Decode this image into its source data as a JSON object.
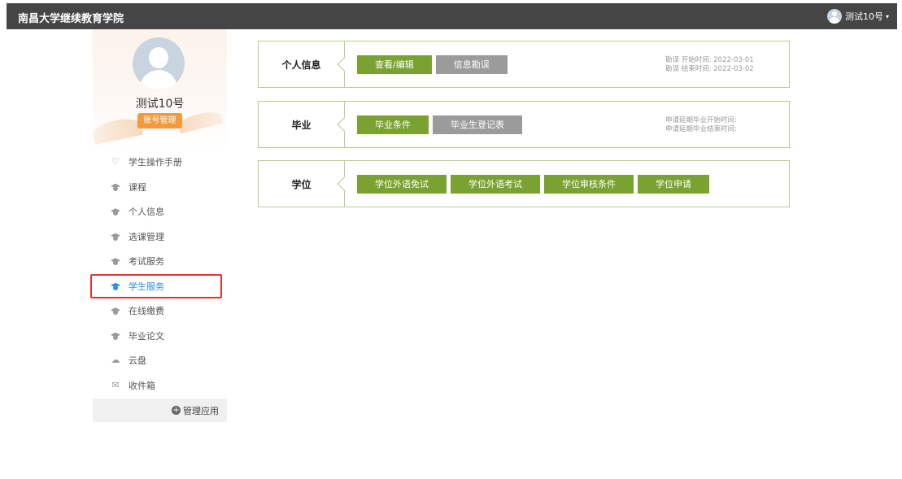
{
  "header": {
    "site_title": "南昌大学继续教育学院",
    "user_name": "测试10号",
    "caret": "▾"
  },
  "profile": {
    "name": "测试10号",
    "account_button": "账号管理"
  },
  "menu": [
    {
      "label": "学生操作手册",
      "icon": "heart-icon"
    },
    {
      "label": "课程",
      "icon": "graduation-cap-icon"
    },
    {
      "label": "个人信息",
      "icon": "graduation-cap-icon"
    },
    {
      "label": "选课管理",
      "icon": "graduation-cap-icon"
    },
    {
      "label": "考试服务",
      "icon": "graduation-cap-icon"
    },
    {
      "label": "学生服务",
      "icon": "graduation-cap-icon",
      "active": true
    },
    {
      "label": "在线缴费",
      "icon": "graduation-cap-icon"
    },
    {
      "label": "毕业论文",
      "icon": "graduation-cap-icon"
    },
    {
      "label": "云盘",
      "icon": "cloud-icon"
    },
    {
      "label": "收件箱",
      "icon": "inbox-icon"
    }
  ],
  "manage_apps": "管理应用",
  "sections": [
    {
      "label": "个人信息",
      "buttons": [
        {
          "label": "查看/编辑",
          "style": "green"
        },
        {
          "label": "信息勘误",
          "style": "gray"
        }
      ],
      "notes": [
        "勘误 开始时间: 2022-03-01",
        "勘误 结束时间: 2022-03-02"
      ]
    },
    {
      "label": "毕业",
      "buttons": [
        {
          "label": "毕业条件",
          "style": "green"
        },
        {
          "label": "毕业生登记表",
          "style": "gray"
        }
      ],
      "notes": [
        "申请延期毕业开始时间:",
        "申请延期毕业结束时间:"
      ]
    },
    {
      "label": "学位",
      "buttons": [
        {
          "label": "学位外语免试",
          "style": "green"
        },
        {
          "label": "学位外语考试",
          "style": "green"
        },
        {
          "label": "学位审核条件",
          "style": "green"
        },
        {
          "label": "学位申请",
          "style": "green"
        }
      ],
      "notes": []
    }
  ],
  "colors": {
    "topbar": "#454545",
    "accent_green": "#7aa230",
    "button_gray": "#9b9b9b",
    "active_blue": "#2d8cf0",
    "account_orange": "#f39a3c",
    "highlight_red": "#e8322b"
  }
}
